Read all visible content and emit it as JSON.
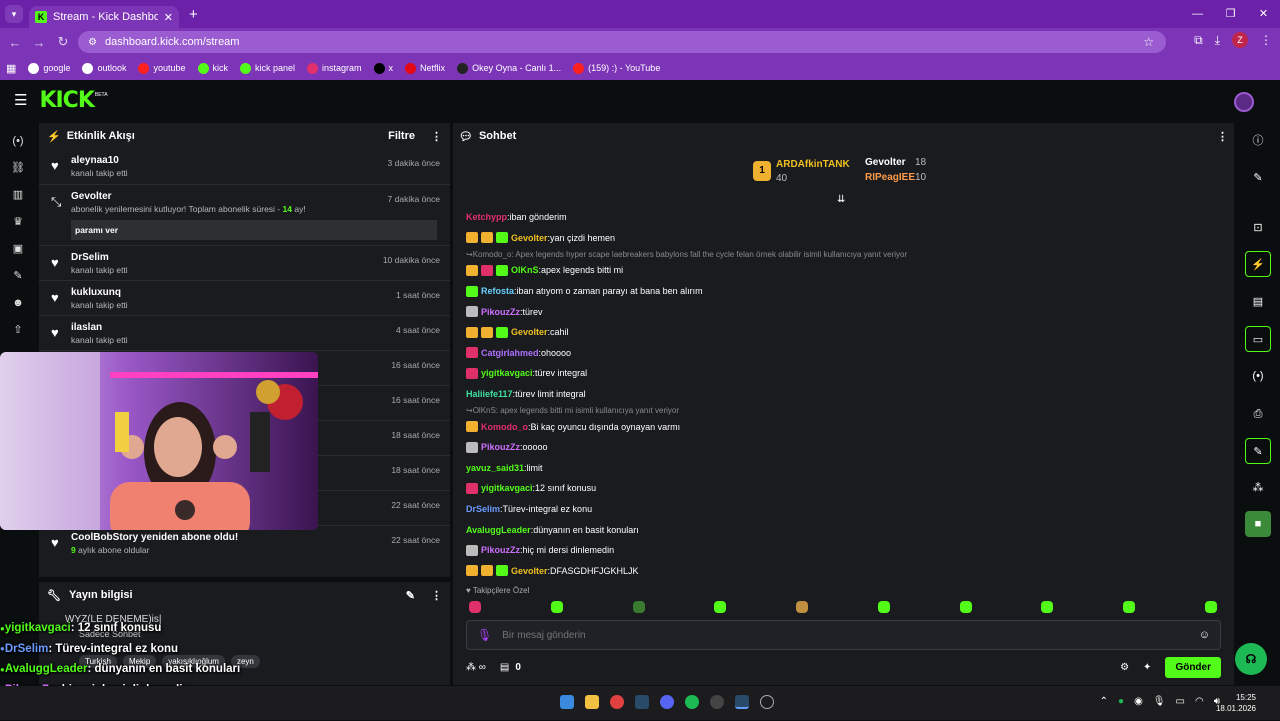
{
  "browser": {
    "tab_title": "Stream - Kick Dashboard",
    "url": "dashboard.kick.com/stream",
    "profile_initial": "Z",
    "bookmarks": [
      {
        "label": "google",
        "color": "#ffffff"
      },
      {
        "label": "outlook",
        "color": "#ffffff"
      },
      {
        "label": "youtube",
        "color": "#ff2020"
      },
      {
        "label": "kick",
        "color": "#53fc18"
      },
      {
        "label": "kick panel",
        "color": "#53fc18"
      },
      {
        "label": "instagram",
        "color": "#e1306c"
      },
      {
        "label": "x",
        "color": "#000000"
      },
      {
        "label": "Netflix",
        "color": "#e50914"
      },
      {
        "label": "Okey Oyna - Canlı 1...",
        "color": "#222222"
      },
      {
        "label": "(159) :) - YouTube",
        "color": "#ff2020"
      }
    ]
  },
  "kick": {
    "logo": "KICK",
    "beta": "BETA"
  },
  "activity": {
    "title": "Etkinlik Akışı",
    "filter": "Filtre",
    "events": [
      {
        "name": "aleynaa10",
        "sub": "kanalı takip etti",
        "time": "3 dakika önce"
      },
      {
        "name": "Gevolter",
        "sub": "abonelik yenilemesini kutluyor! Toplam abonelik süresi - ",
        "sub_num": "14",
        "sub_tail": " ay!",
        "message": "paramı ver",
        "time": "7 dakika önce"
      },
      {
        "name": "DrSelim",
        "sub": "kanalı takip etti",
        "time": "10 dakika önce"
      },
      {
        "name": "kukluxunq",
        "sub": "kanalı takip etti",
        "time": "1 saat önce"
      },
      {
        "name": "ilaslan",
        "sub": "kanalı takip etti",
        "time": "4 saat önce"
      },
      {
        "name": "",
        "sub": "",
        "time": "16 saat önce"
      },
      {
        "name": "",
        "sub": "",
        "time": "16 saat önce"
      },
      {
        "name": "",
        "sub": "",
        "time": "18 saat önce"
      },
      {
        "name": "",
        "sub": "",
        "time": "18 saat önce"
      },
      {
        "name": "",
        "sub": "",
        "time": "22 saat önce"
      },
      {
        "name": "CoolBobStory yeniden abone oldu!",
        "sub_num": "9",
        "sub": " aylık abone oldular",
        "time": "22 saat önce"
      }
    ]
  },
  "stream_info": {
    "title": "Yayın bilgisi",
    "stream_title": "WYZ(LE DENEME)is|",
    "category": "Sadece Sohbet",
    "tags": [
      "Turkish",
      "Mekip",
      "yakışıklıoğlum",
      "zeyn"
    ]
  },
  "chat": {
    "title": "Sohbet",
    "leaderboard": [
      {
        "rank": "1",
        "name": "ARDAfkinTANK",
        "count": "40"
      },
      {
        "name": "Gevolter",
        "count": "18"
      },
      {
        "name": "RIPeagIEE",
        "count": "10"
      }
    ],
    "messages": [
      {
        "user": "Ketchypp",
        "color": "#e0306a",
        "text": "iban gönderim",
        "badges": []
      },
      {
        "user": "Gevolter",
        "color": "#f0c020",
        "text": "yan çizdi hemen",
        "badges": [
          "#f0b030",
          "#f0b030",
          "#53fc18"
        ]
      },
      {
        "reply": "Komodo_o: Apex legends hyper scape laebreakers babylons fall the cycle felan örnek olabilir isimli kullanıcıya yanıt veriyor"
      },
      {
        "user": "OlKnS",
        "color": "#53fc18",
        "text": "apex legends bitti mi",
        "badges": [
          "#f0b030",
          "#e0306a",
          "#53fc18"
        ]
      },
      {
        "user": "Refosta",
        "color": "#6bd0ff",
        "text": "iban atıyom o zaman parayı at bana ben alırım",
        "badges": [
          "#53fc18"
        ]
      },
      {
        "user": "PikouzZz",
        "color": "#d070ff",
        "text": "türev",
        "badges": [
          "#bbbbbb"
        ]
      },
      {
        "user": "Gevolter",
        "color": "#f0c020",
        "text": "cahil",
        "badges": [
          "#f0b030",
          "#f0b030",
          "#53fc18"
        ]
      },
      {
        "user": "Catgirlahmed",
        "color": "#b070ff",
        "text": "ohoooo",
        "badges": [
          "#e0306a"
        ]
      },
      {
        "user": "yigitkavgaci",
        "color": "#53fc18",
        "text": "türev integral",
        "badges": [
          "#e0306a"
        ]
      },
      {
        "user": "Haliiefe117",
        "color": "#40e0a0",
        "text": "türev limit integral",
        "badges": []
      },
      {
        "reply": "OlKnS: apex legends bitti mi isimli kullanıcıya yanıt veriyor"
      },
      {
        "user": "Komodo_o",
        "color": "#e0306a",
        "text": "Bi kaç oyuncu dışında oynayan varmı",
        "badges": [
          "#f0b030"
        ]
      },
      {
        "user": "PikouzZz",
        "color": "#d070ff",
        "text": "ooooo",
        "badges": [
          "#bbbbbb"
        ]
      },
      {
        "user": "yavuz_said31",
        "color": "#53fc18",
        "text": "limit",
        "badges": []
      },
      {
        "user": "yigitkavgaci",
        "color": "#53fc18",
        "text": "12 sınıf konusu",
        "badges": [
          "#e0306a"
        ]
      },
      {
        "user": "DrSelim",
        "color": "#6b9bff",
        "text": "Türev-integral ez konu",
        "badges": []
      },
      {
        "user": "AvaluggLeader",
        "color": "#53fc18",
        "text": "dünyanın en basit konuları",
        "badges": []
      },
      {
        "user": "PikouzZz",
        "color": "#d070ff",
        "text": "hiç mi dersi dinlemedin",
        "badges": [
          "#bbbbbb"
        ]
      },
      {
        "user": "Gevolter",
        "color": "#f0c020",
        "text": "DFASGDHFJGKHLJK",
        "badges": [
          "#f0b030",
          "#f0b030",
          "#53fc18"
        ]
      }
    ],
    "followers_label": "Takipçilere Özel",
    "input_placeholder": "Bir mesaj gönderin",
    "footer_count": "0",
    "send_label": "Gönder"
  },
  "overlay": [
    {
      "user": "yigitkavgaci",
      "color": "#53fc18",
      "text": " : 12 sınıf konusu"
    },
    {
      "user": "DrSelim",
      "color": "#6b9bff",
      "text": " : Türev-integral ez konu"
    },
    {
      "user": "AvaluggLeader",
      "color": "#53fc18",
      "text": " : dünyanın en basit konuları"
    },
    {
      "user": "PikouzZz",
      "color": "#d070ff",
      "text": " : hiç mi dersi dinlemedin"
    },
    {
      "user": "Gevolter",
      "color": "#f0c020",
      "text": " : DFASGDHFJGKHLJK"
    }
  ],
  "taskbar": {
    "time": "15:25",
    "date": "18.01.2026"
  }
}
